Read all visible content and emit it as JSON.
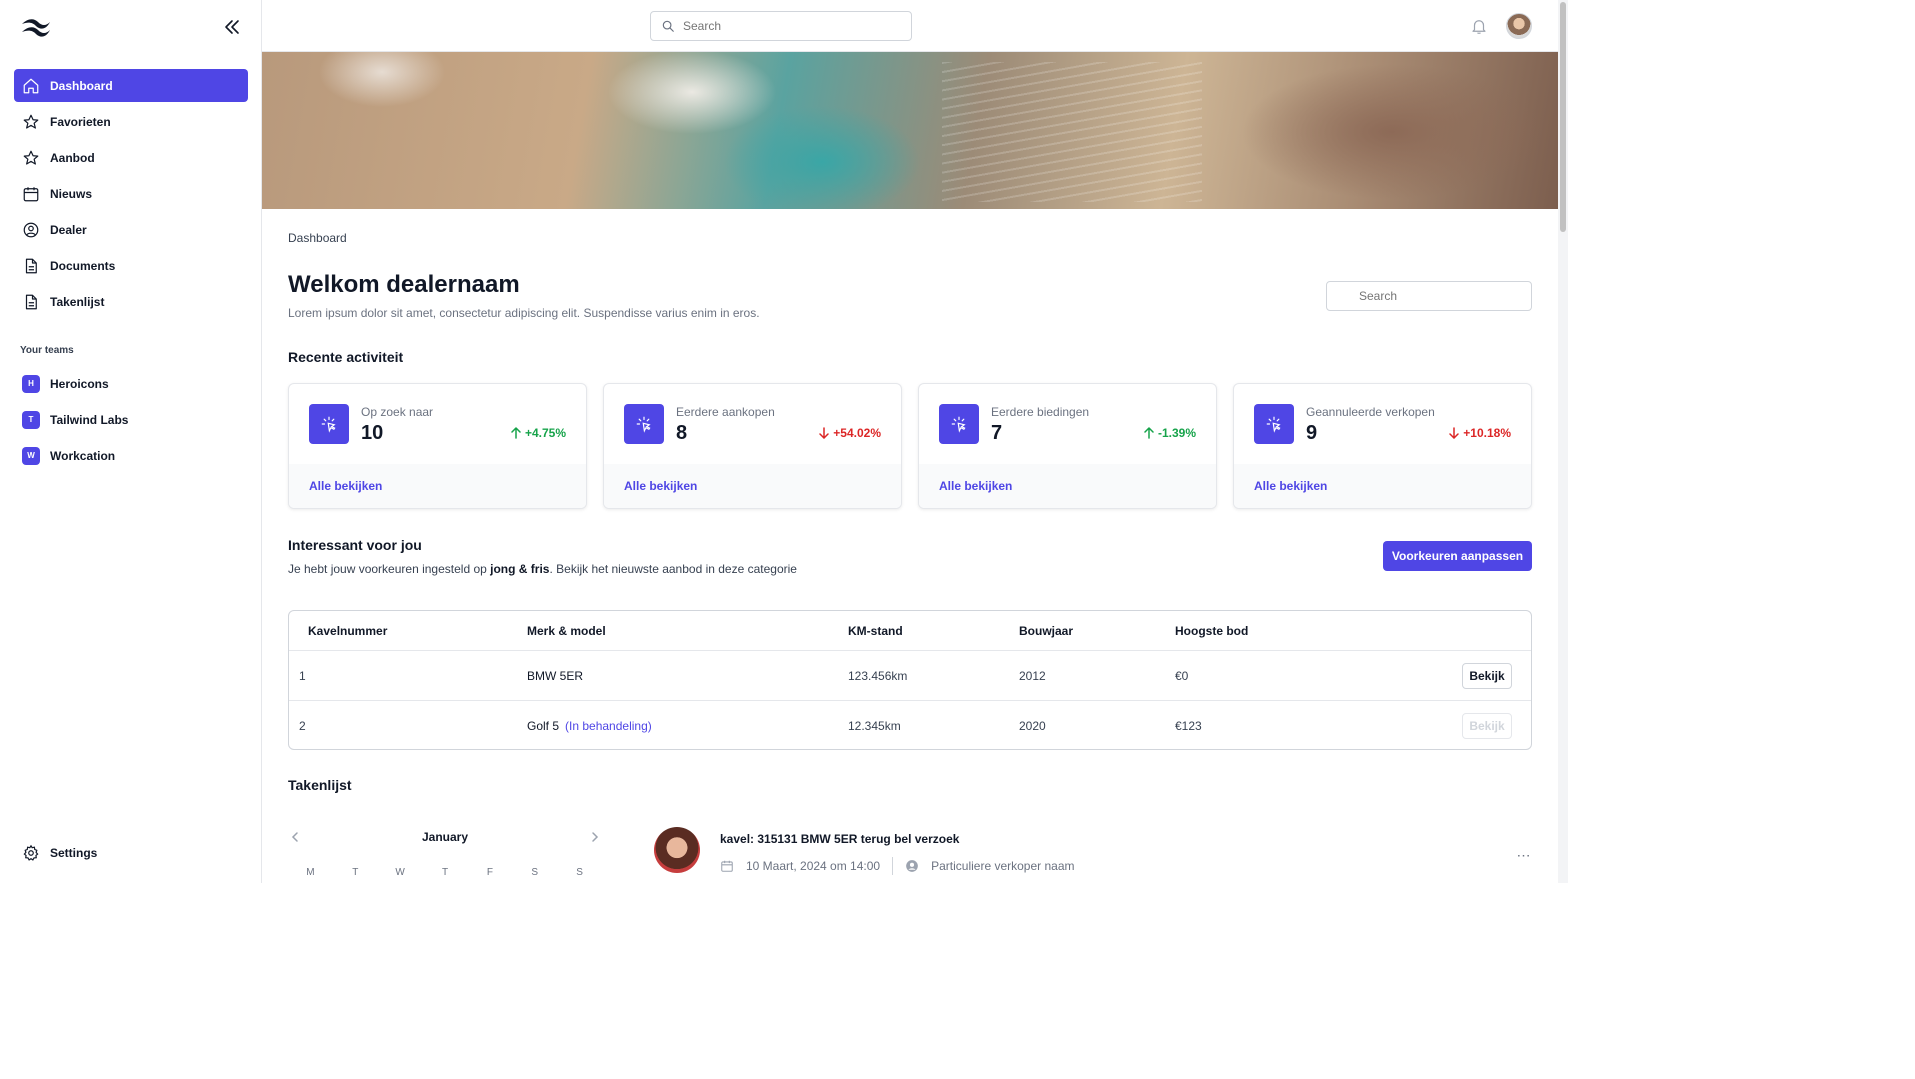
{
  "sidebar": {
    "nav": [
      {
        "label": "Dashboard",
        "icon": "home-icon",
        "active": true
      },
      {
        "label": "Favorieten",
        "icon": "star-icon"
      },
      {
        "label": "Aanbod",
        "icon": "star-icon"
      },
      {
        "label": "Nieuws",
        "icon": "calendar-icon"
      },
      {
        "label": "Dealer",
        "icon": "user-circle-icon"
      },
      {
        "label": "Documents",
        "icon": "document-icon"
      },
      {
        "label": "Takenlijst",
        "icon": "document-icon"
      }
    ],
    "teams_title": "Your teams",
    "teams": [
      {
        "initial": "H",
        "label": "Heroicons"
      },
      {
        "initial": "T",
        "label": "Tailwind Labs"
      },
      {
        "initial": "W",
        "label": "Workcation"
      }
    ],
    "settings_label": "Settings"
  },
  "topbar": {
    "search_placeholder": "Search"
  },
  "main": {
    "breadcrumb": "Dashboard",
    "title": "Welkom dealernaam",
    "description": "Lorem ipsum dolor sit amet, consectetur adipiscing elit. Suspendisse varius enim in eros.",
    "search_placeholder": "Search",
    "recent_title": "Recente activiteit",
    "stats": [
      {
        "label": "Op zoek naar",
        "value": "10",
        "change": "+4.75%",
        "direction": "up",
        "link": "Alle bekijken"
      },
      {
        "label": "Eerdere aankopen",
        "value": "8",
        "change": "+54.02%",
        "direction": "down",
        "link": "Alle bekijken"
      },
      {
        "label": "Eerdere biedingen",
        "value": "7",
        "change": "-1.39%",
        "direction": "up",
        "link": "Alle bekijken"
      },
      {
        "label": "Geannuleerde verkopen",
        "value": "9",
        "change": "+10.18%",
        "direction": "down",
        "link": "Alle bekijken"
      }
    ],
    "interest": {
      "title": "Interessant voor jou",
      "desc_before": "Je hebt jouw voorkeuren ingesteld op ",
      "desc_bold": "jong & fris",
      "desc_after": ". Bekijk het nieuwste aanbod in deze categorie",
      "button": "Voorkeuren aanpassen"
    },
    "table": {
      "headers": [
        "Kavelnummer",
        "Merk & model",
        "KM-stand",
        "Bouwjaar",
        "Hoogste bod"
      ],
      "rows": [
        {
          "kavel": "1",
          "model": "BMW 5ER",
          "status": "",
          "km": "123.456km",
          "year": "2012",
          "bid": "€0",
          "action": "Bekijk",
          "disabled": false
        },
        {
          "kavel": "2",
          "model": "Golf 5",
          "status": "(In behandeling)",
          "km": "12.345km",
          "year": "2020",
          "bid": "€123",
          "action": "Bekijk",
          "disabled": true
        }
      ]
    },
    "tasks_title": "Takenlijst",
    "calendar": {
      "month": "January",
      "days": [
        "M",
        "T",
        "W",
        "T",
        "F",
        "S",
        "S"
      ]
    },
    "task": {
      "title": "kavel: 315131 BMW 5ER terug bel verzoek",
      "date": "10 Maart, 2024 om 14:00",
      "person": "Particuliere verkoper naam"
    }
  },
  "colors": {
    "accent": "#4f46e5",
    "positive": "#16a34a",
    "negative": "#dc2626"
  }
}
